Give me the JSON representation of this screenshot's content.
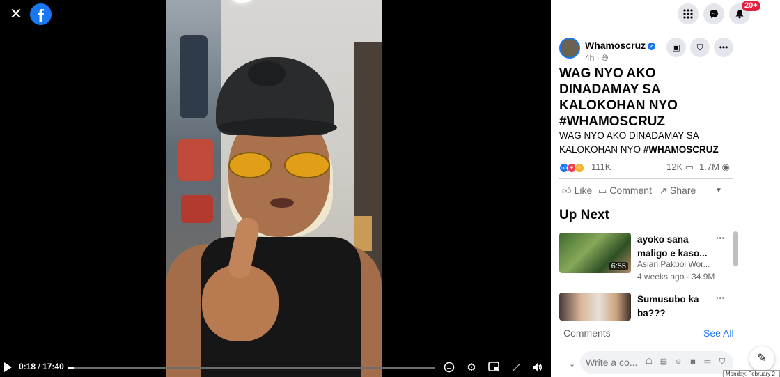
{
  "player": {
    "current_time": "0:18",
    "separator": " / ",
    "duration": "17:40",
    "progress": 0.017
  },
  "header": {
    "notifications_badge": "20+"
  },
  "post": {
    "author": "Whamoscruz",
    "time_ago": "4h",
    "headline": "WAG NYO AKO DINADAMAY SA KALOKOHAN NYO #WHAMOSCRUZ",
    "description_text": "WAG NYO AKO DINADAMAY SA KALOKOHAN NYO ",
    "description_tag": "#WHAMOSCRUZ",
    "reactions_count": "111K",
    "comments_count": "12K",
    "views_count": "1.7M",
    "actions": {
      "like": "Like",
      "comment": "Comment",
      "share": "Share"
    }
  },
  "up_next": {
    "title": "Up Next",
    "items": [
      {
        "title": "ayoko sana maligo e kaso...",
        "channel": "Asian Pakboi Wor...",
        "meta": "4 weeks ago · 34.9M",
        "duration": "6:55"
      },
      {
        "title": "Sumusubo ka ba???"
      }
    ]
  },
  "comments": {
    "label": "Comments",
    "see_all": "See All",
    "placeholder": "Write a co..."
  },
  "tooltip": "Monday, February 2",
  "colors": {
    "brand": "#1877f2",
    "badge": "#e41e3f"
  }
}
